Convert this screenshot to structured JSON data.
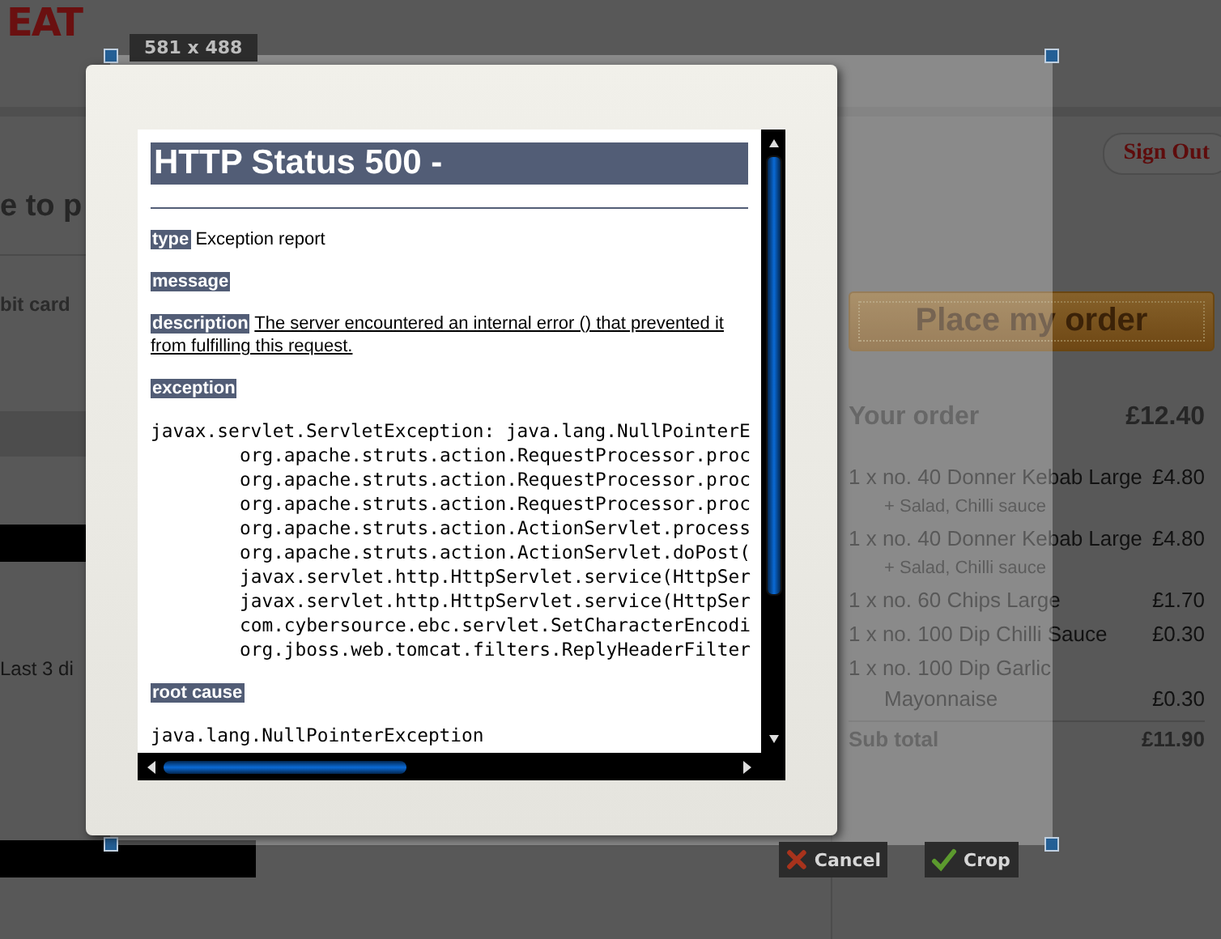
{
  "background_page": {
    "logo": "EAT",
    "heading": "e to p",
    "card_label": "bit card",
    "hint": "Last 3 di",
    "sign_out": "Sign Out",
    "place_order": "Place my order",
    "order": {
      "title": "Your order",
      "total": "£12.40",
      "items": [
        {
          "name": "1 x no. 40 Donner Kebab Large",
          "price": "£4.80",
          "extras": "+ Salad, Chilli sauce"
        },
        {
          "name": "1 x no. 40 Donner Kebab Large",
          "price": "£4.80",
          "extras": "+ Salad, Chilli sauce"
        },
        {
          "name": "1 x no. 60 Chips Large",
          "price": "£1.70"
        },
        {
          "name": "1 x no. 100 Dip Chilli Sauce",
          "price": "£0.30"
        },
        {
          "name": "1 x no. 100 Dip Garlic Mayonnaise",
          "price": "£0.30"
        }
      ],
      "subtotal_label": "Sub total",
      "subtotal": "£11.90"
    }
  },
  "crop_tool": {
    "size": "581 x 488",
    "cancel": "Cancel",
    "confirm": "Crop"
  },
  "error_page": {
    "title": "HTTP Status 500 -",
    "fields": [
      {
        "label": "type",
        "text": "Exception report"
      },
      {
        "label": "message"
      },
      {
        "label": "description",
        "text": "The server encountered an internal error () that prevented it from fulfilling this request."
      }
    ],
    "exception_label": "exception",
    "stack": [
      {
        "kind": "head",
        "text": "javax.servlet.ServletException: java.lang.NullPointerE"
      },
      {
        "kind": "frame",
        "text": "org.apache.struts.action.RequestProcessor.proc"
      },
      {
        "kind": "frame",
        "text": "org.apache.struts.action.RequestProcessor.proc"
      },
      {
        "kind": "frame",
        "text": "org.apache.struts.action.RequestProcessor.proc"
      },
      {
        "kind": "frame",
        "text": "org.apache.struts.action.ActionServlet.process"
      },
      {
        "kind": "frame",
        "text": "org.apache.struts.action.ActionServlet.doPost("
      },
      {
        "kind": "frame",
        "text": "javax.servlet.http.HttpServlet.service(HttpSer"
      },
      {
        "kind": "frame",
        "text": "javax.servlet.http.HttpServlet.service(HttpSer"
      },
      {
        "kind": "frame",
        "text": "com.cybersource.ebc.servlet.SetCharacterEncodi"
      },
      {
        "kind": "frame",
        "text": "org.jboss.web.tomcat.filters.ReplyHeaderFilter"
      }
    ],
    "root_cause_label": "root cause",
    "root_cause": "java.lang.NullPointerException"
  }
}
